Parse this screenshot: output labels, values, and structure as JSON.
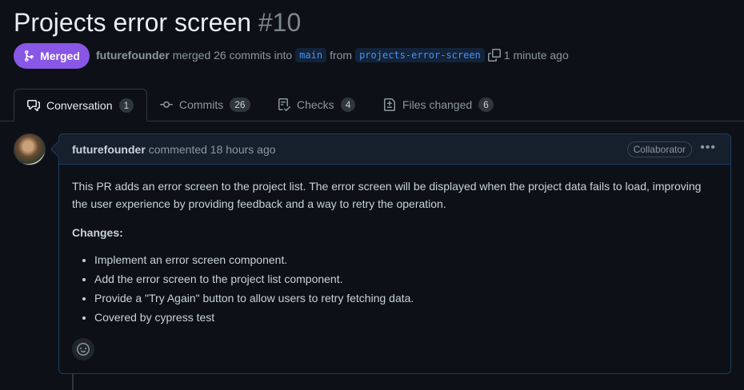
{
  "pr": {
    "title": "Projects error screen",
    "number": "#10",
    "state": "Merged",
    "author": "futurefounder",
    "merged_text": "merged 26 commits into",
    "base_branch": "main",
    "from_text": "from",
    "head_branch": "projects-error-screen",
    "time": "1 minute ago"
  },
  "tabs": [
    {
      "label": "Conversation",
      "count": "1"
    },
    {
      "label": "Commits",
      "count": "26"
    },
    {
      "label": "Checks",
      "count": "4"
    },
    {
      "label": "Files changed",
      "count": "6"
    }
  ],
  "comment": {
    "author": "futurefounder",
    "action": "commented 18 hours ago",
    "role": "Collaborator",
    "intro": "This PR adds an error screen to the project list. The error screen will be displayed when the project data fails to load, improving the user experience by providing feedback and a way to retry the operation.",
    "changes_heading": "Changes:",
    "items": [
      "Implement an error screen component.",
      "Add the error screen to the project list component.",
      "Provide a \"Try Again\" button to allow users to retry fetching data.",
      "Covered by cypress test"
    ]
  },
  "colors": {
    "merged": "#8957e5",
    "background": "#0d1117",
    "link": "#4493f8"
  }
}
